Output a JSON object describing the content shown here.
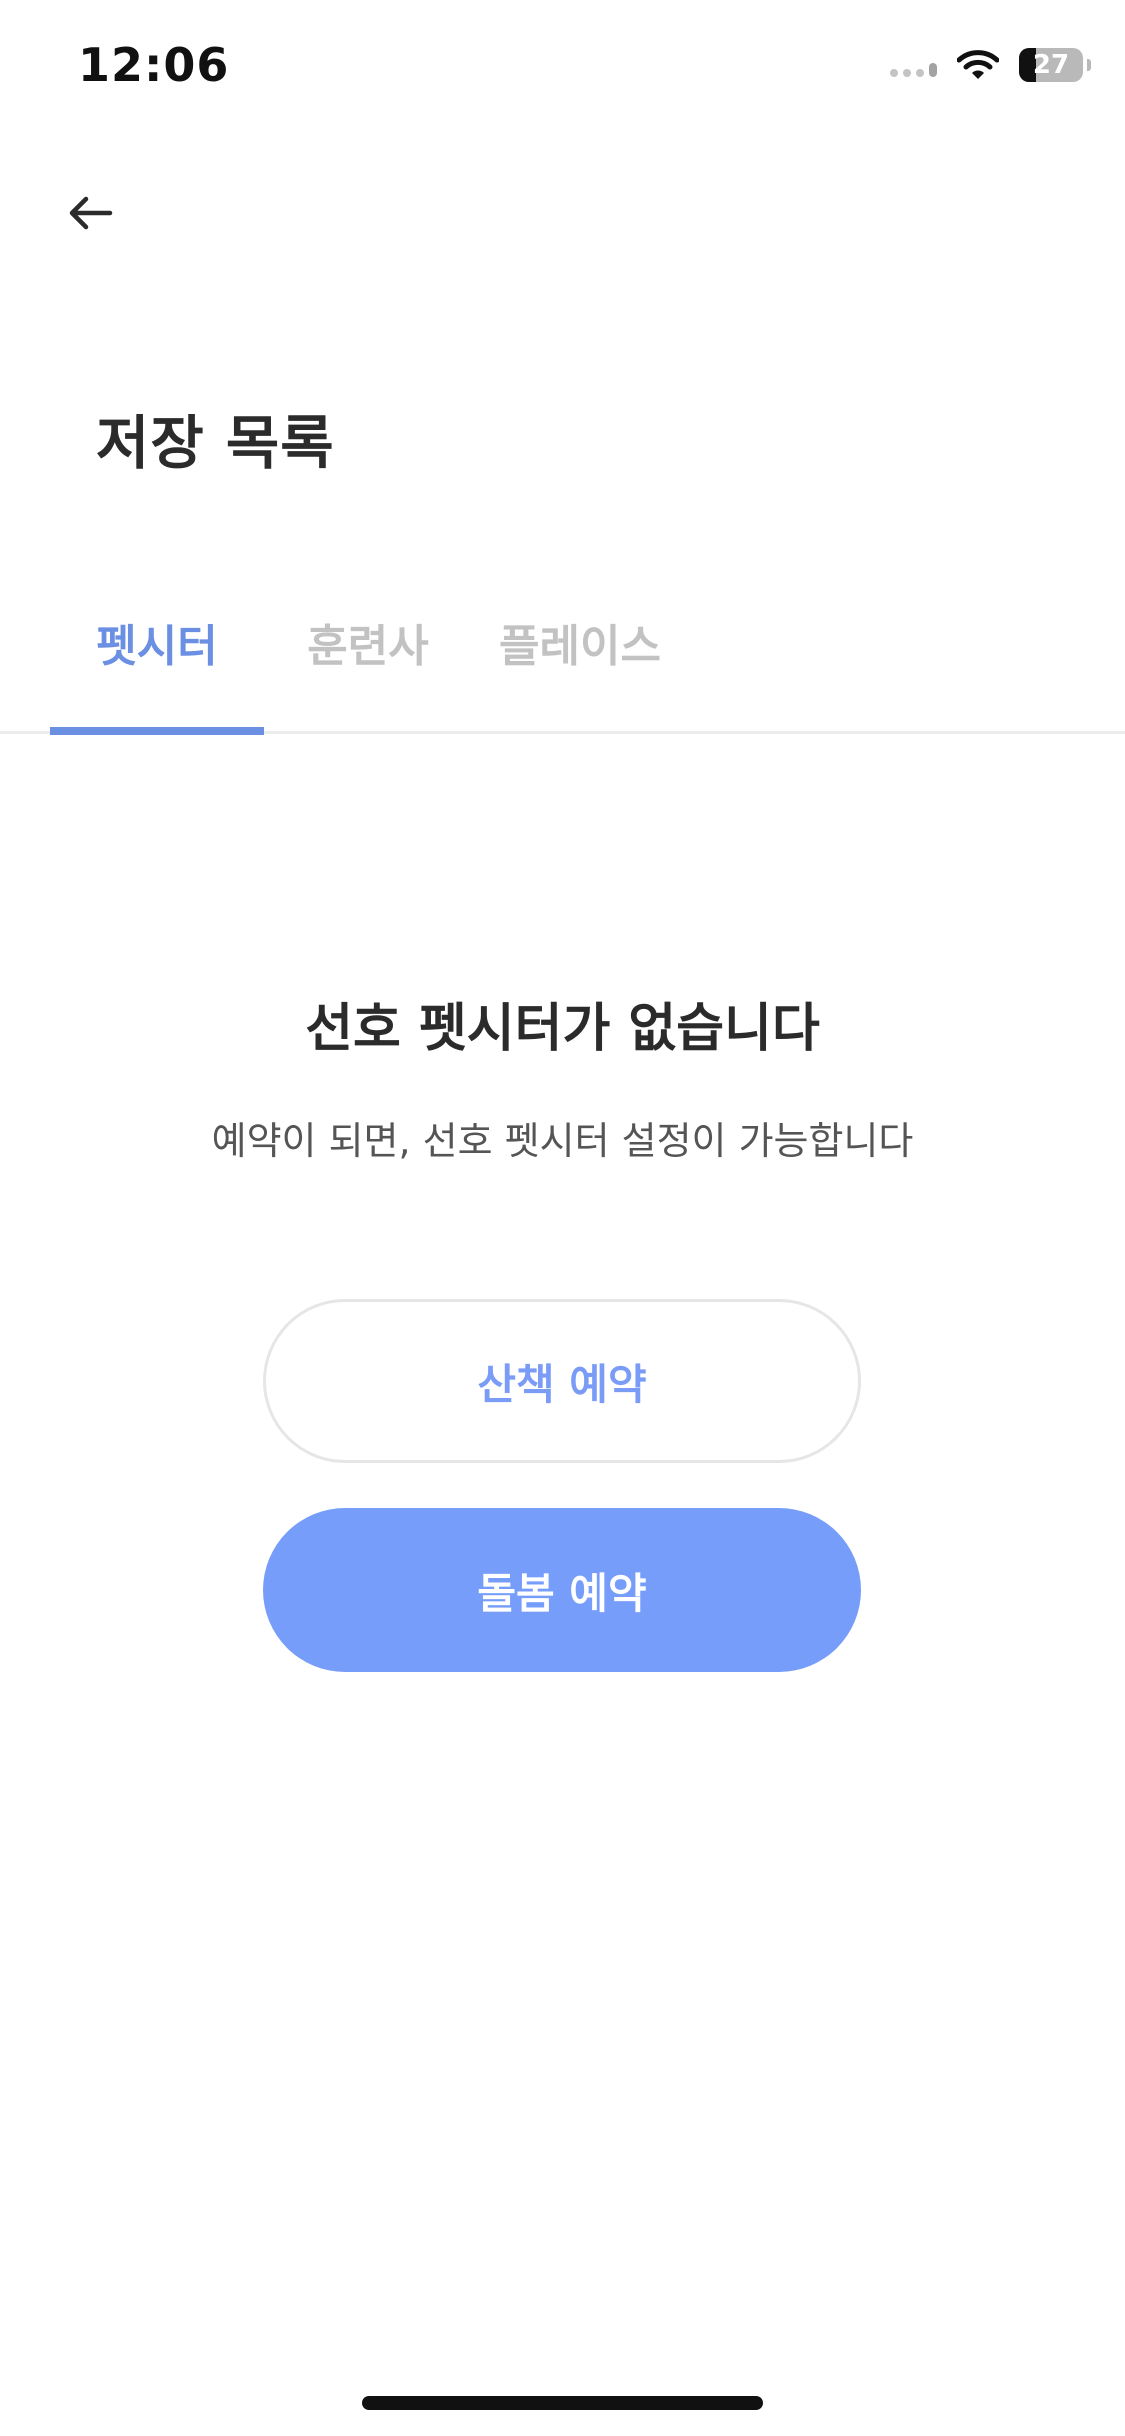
{
  "status_bar": {
    "time": "12:06",
    "battery_level": "27",
    "icons": [
      "cellular-signal-icon",
      "wifi-icon",
      "battery-icon"
    ]
  },
  "header": {
    "back_icon": "arrow-left-icon",
    "title": "저장 목록"
  },
  "tabs": [
    {
      "label": "펫시터",
      "active": true
    },
    {
      "label": "훈련사",
      "active": false
    },
    {
      "label": "플레이스",
      "active": false
    }
  ],
  "empty_state": {
    "title": "선호 펫시터가 없습니다",
    "subtitle": "예약이 되면, 선호 펫시터 설정이 가능합니다"
  },
  "actions": {
    "walk_booking_label": "산책 예약",
    "care_booking_label": "돌봄 예약"
  },
  "colors": {
    "accent": "#6a8fe3",
    "primary_button": "#779dfb",
    "secondary_button_text": "#7a9cf7",
    "inactive_tab": "#c2c2c2",
    "text_primary": "#2b2b2b"
  }
}
